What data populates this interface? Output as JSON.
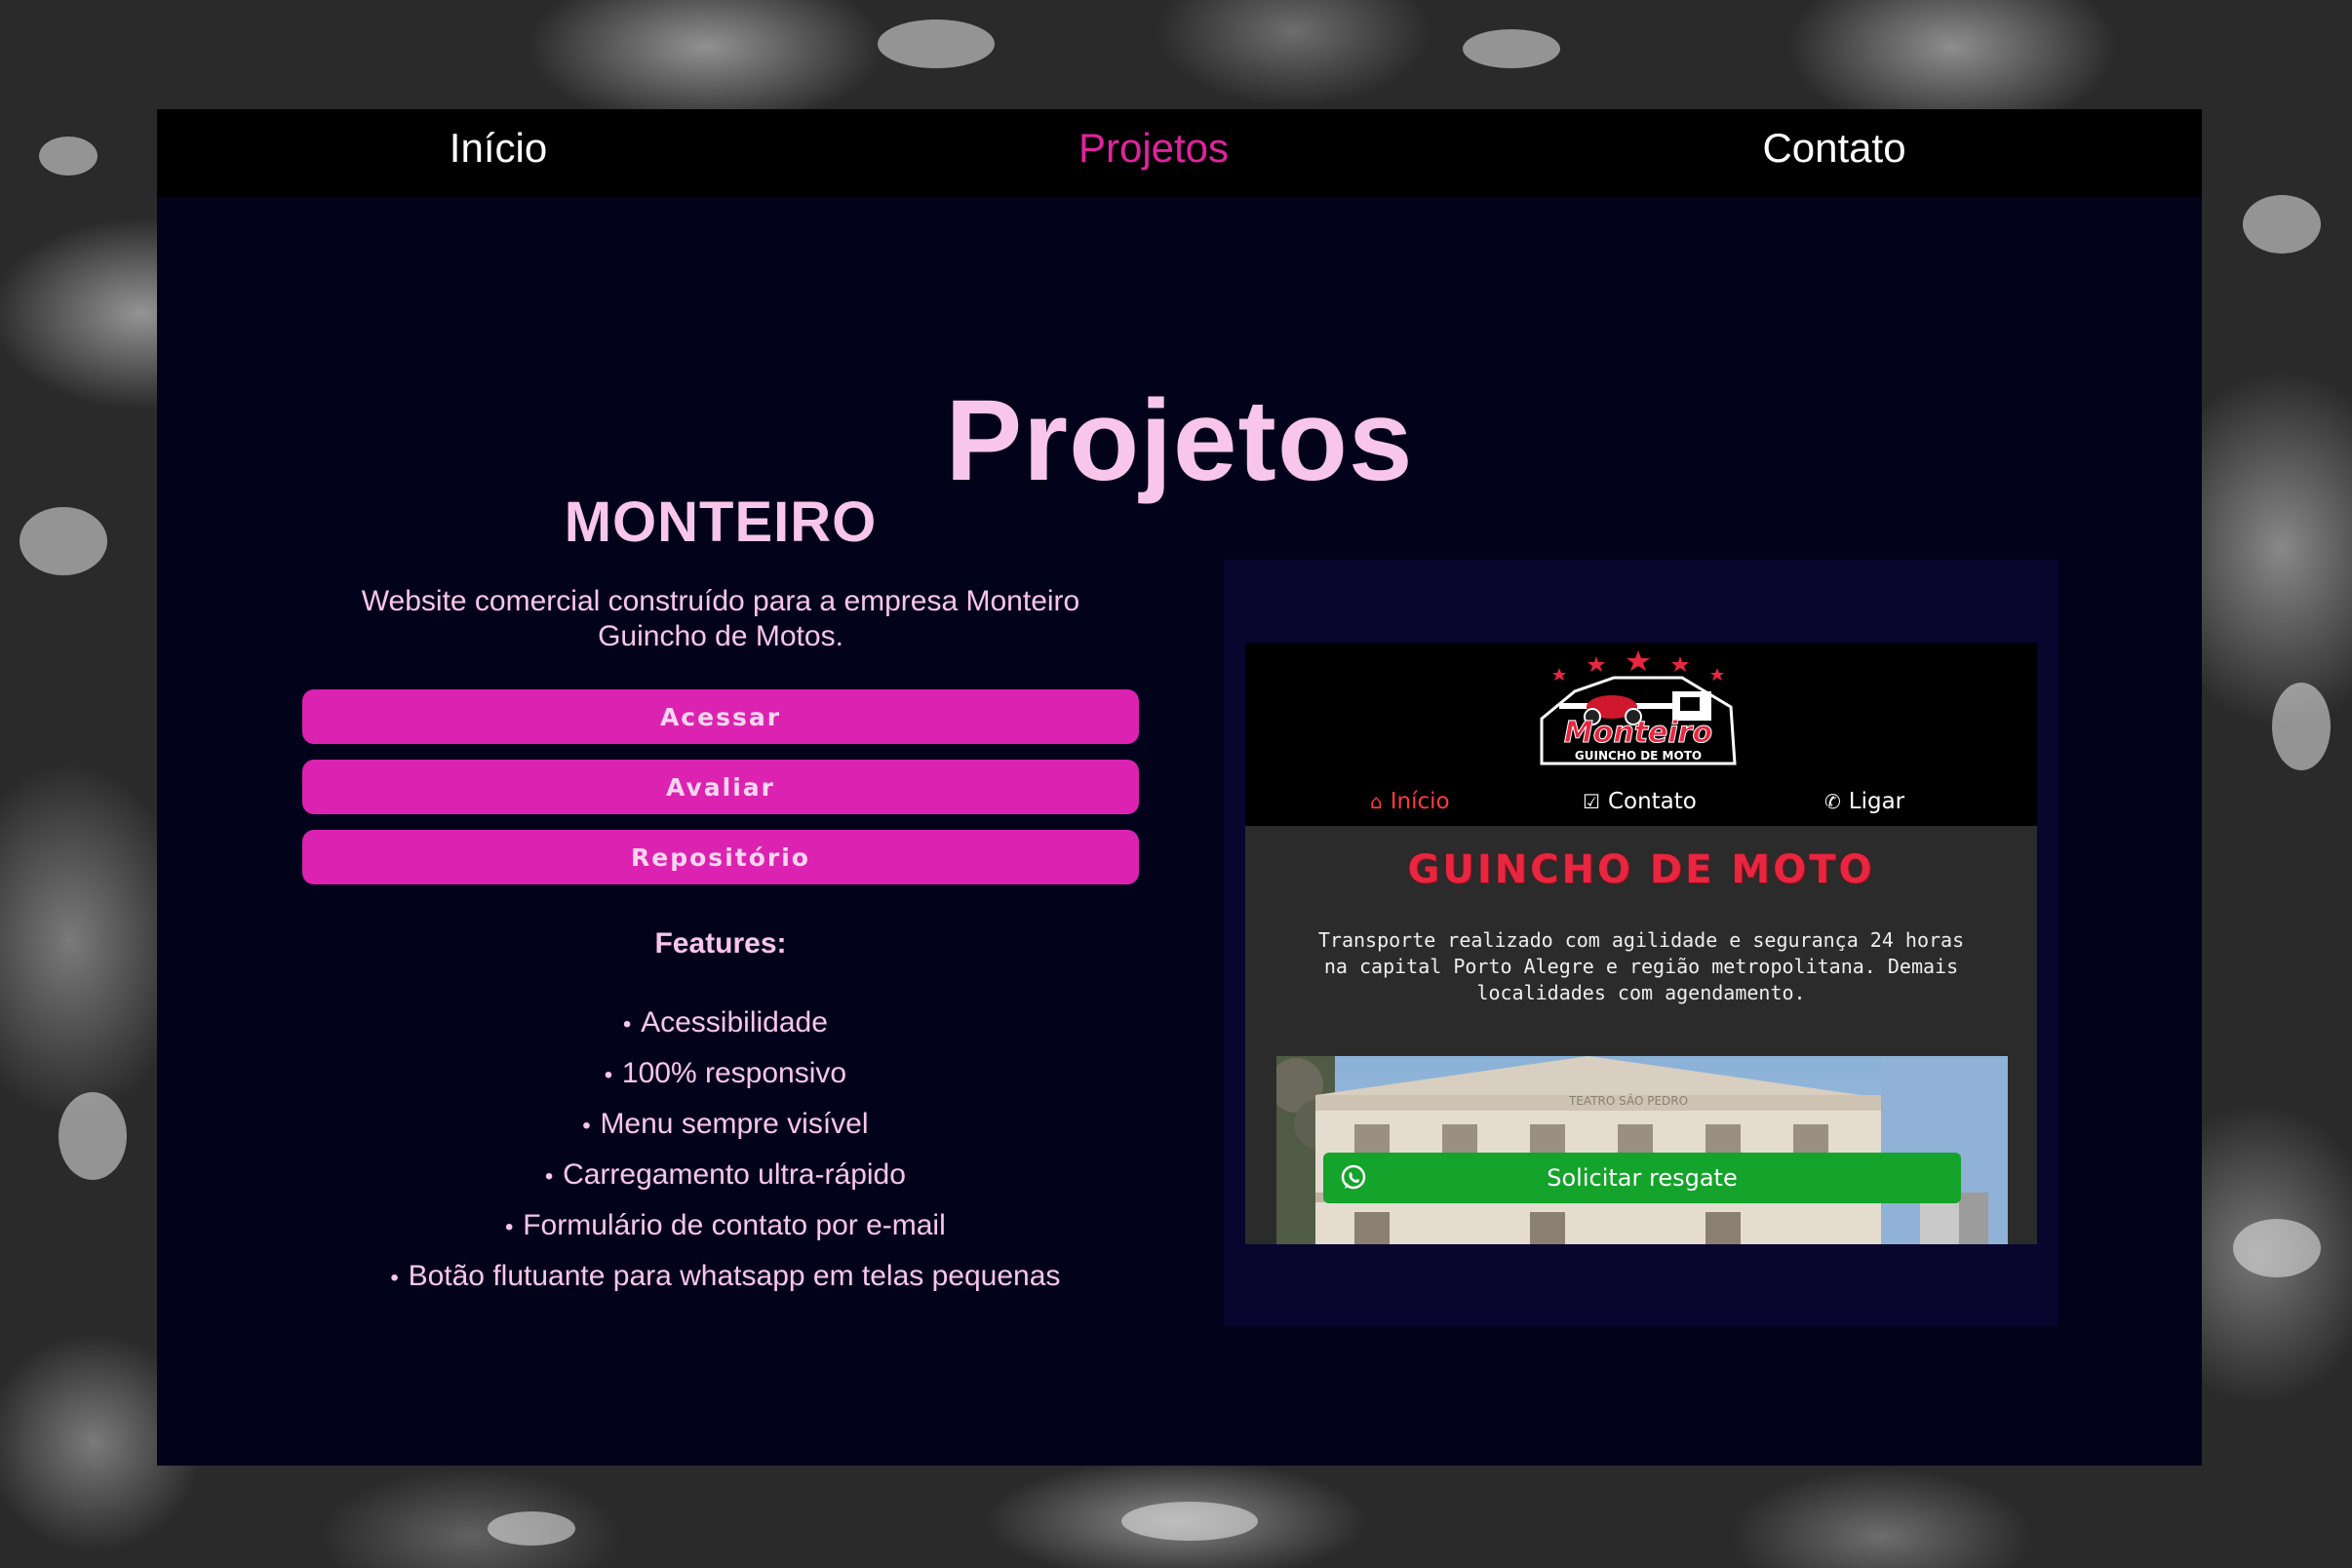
{
  "nav": {
    "items": [
      {
        "label": "Início",
        "active": false
      },
      {
        "label": "Projetos",
        "active": true
      },
      {
        "label": "Contato",
        "active": false
      }
    ]
  },
  "page": {
    "title": "Projetos"
  },
  "project": {
    "name": "MONTEIRO",
    "description": "Website comercial construído para a empresa Monteiro Guincho de Motos.",
    "buttons": {
      "access": "Acessar",
      "review": "Avaliar",
      "repo": "Repositório"
    },
    "features_title": "Features:",
    "features": [
      "Acessibilidade",
      "100% responsivo",
      "Menu sempre visível",
      "Carregamento ultra-rápido",
      "Formulário de contato por e-mail",
      "Botão flutuante para whatsapp em telas pequenas"
    ]
  },
  "preview": {
    "logo": {
      "name": "Monteiro",
      "tagline": "GUINCHO DE MOTO"
    },
    "nav": {
      "home": "Início",
      "contact": "Contato",
      "call": "Ligar"
    },
    "headline": "GUINCHO DE MOTO",
    "text_lines": [
      "Transporte realizado com agilidade e segurança 24 horas",
      "na capital Porto Alegre e região metropolitana. Demais",
      "localidades com agendamento."
    ],
    "photo_sign": "TEATRO SÃO PEDRO",
    "cta": "Solicitar resgate"
  },
  "colors": {
    "accent": "#dc22b1",
    "active_nav": "#e0239e",
    "text_pink": "#f8c6ea",
    "panel_bg": "#03021b",
    "preview_red": "#e8263f",
    "whatsapp_green": "#14a32b"
  },
  "icons": {
    "preview_home": "home-icon",
    "preview_contact": "checkbox-icon",
    "preview_call": "phone-icon",
    "cta": "whatsapp-icon"
  }
}
